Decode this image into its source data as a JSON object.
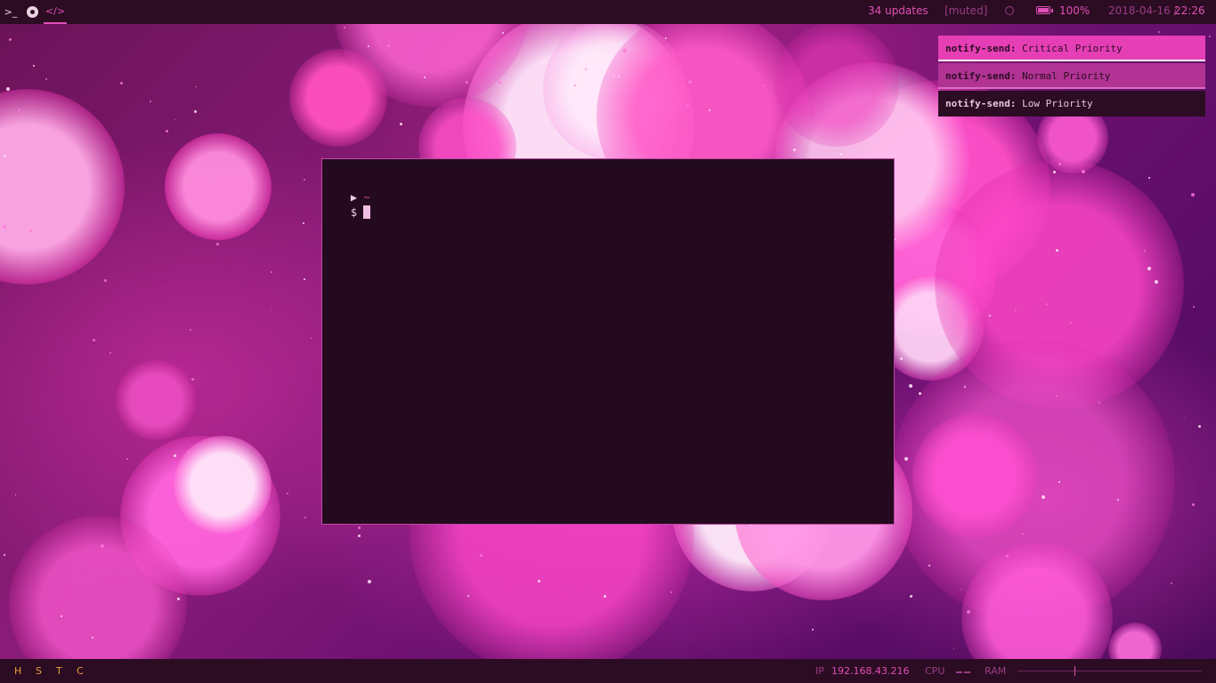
{
  "colors": {
    "accent": "#e24fb8",
    "bar_bg": "#2b0c22",
    "terminal_bg": "#240a1f",
    "critical_bg": "#e63fb6",
    "normal_bg": "#b03393",
    "low_bg": "#2b0c22",
    "workspace_letters": "#e8a13a"
  },
  "topbar": {
    "workspaces": [
      {
        "icon": "terminal-icon",
        "glyph": ">_",
        "active": false
      },
      {
        "icon": "chrome-icon",
        "glyph": "◉",
        "active": false
      },
      {
        "icon": "code-icon",
        "glyph": "</>",
        "active": true
      }
    ],
    "updates": "34 updates",
    "volume": "[muted]",
    "clock_icon": "clock-icon",
    "battery_icon": "battery-icon",
    "battery": "100%",
    "date": "2018-04-16 /",
    "time": "22:26"
  },
  "notifications": [
    {
      "priority": "critical",
      "source": "notify-send:",
      "message": "Critical Priority"
    },
    {
      "priority": "normal",
      "source": "notify-send:",
      "message": "Normal Priority"
    },
    {
      "priority": "low",
      "source": "notify-send:",
      "message": "Low Priority"
    }
  ],
  "terminal": {
    "arrow": "▶",
    "cwd": "~",
    "prompt": "$"
  },
  "bottombar": {
    "workspace_letters": [
      "H",
      "S",
      "T",
      "C"
    ],
    "ip_label": "IP",
    "ip_value": "192.168.43.216",
    "cpu_label": "CPU",
    "ram_label": "RAM",
    "ram_level": 0.31
  }
}
